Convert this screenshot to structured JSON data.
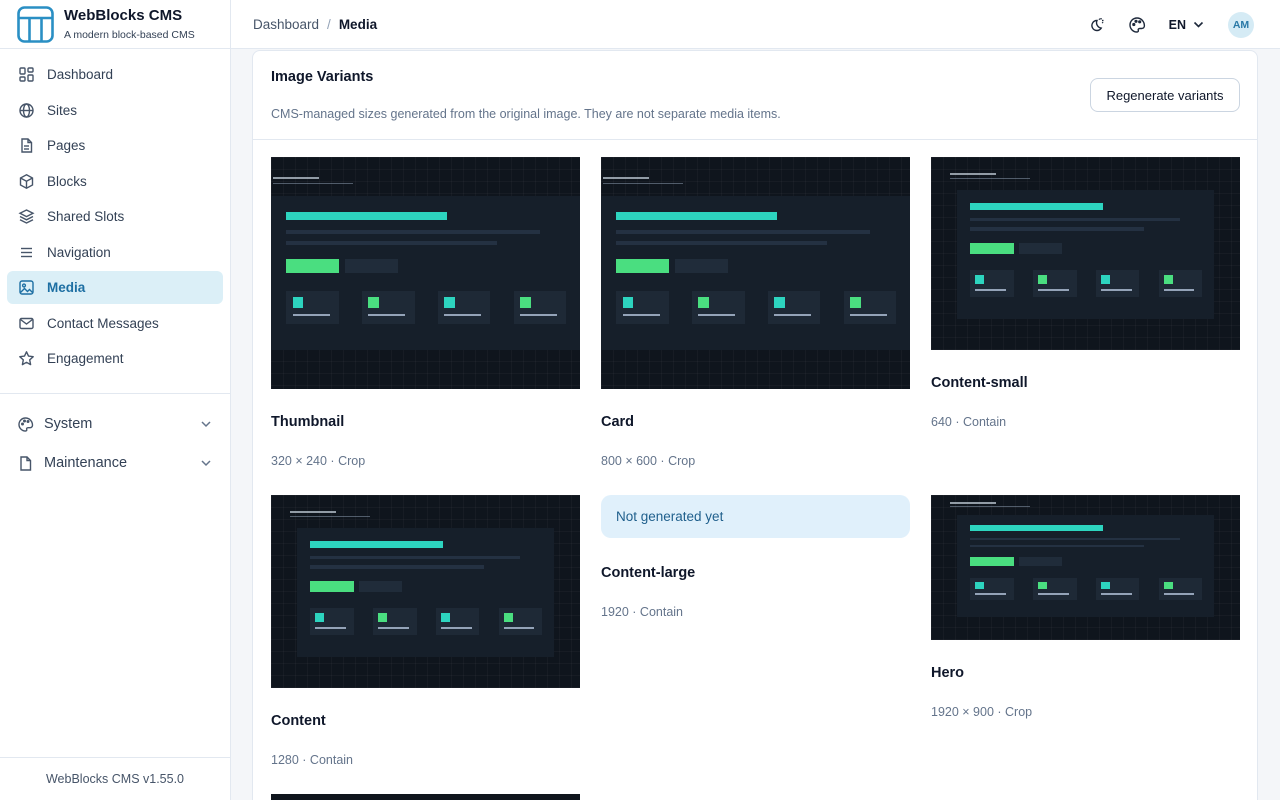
{
  "brand": {
    "title": "WebBlocks CMS",
    "subtitle": "A modern block-based CMS"
  },
  "nav": [
    {
      "label": "Dashboard",
      "icon": "dashboard-icon"
    },
    {
      "label": "Sites",
      "icon": "globe-icon"
    },
    {
      "label": "Pages",
      "icon": "page-icon"
    },
    {
      "label": "Blocks",
      "icon": "cube-icon"
    },
    {
      "label": "Shared Slots",
      "icon": "layers-icon"
    },
    {
      "label": "Navigation",
      "icon": "menu-icon"
    },
    {
      "label": "Media",
      "icon": "image-icon",
      "active": true
    },
    {
      "label": "Contact Messages",
      "icon": "mail-icon"
    },
    {
      "label": "Engagement",
      "icon": "star-icon"
    }
  ],
  "nav_groups": [
    {
      "label": "System",
      "icon": "palette-icon"
    },
    {
      "label": "Maintenance",
      "icon": "file-icon"
    }
  ],
  "footer": {
    "version": "WebBlocks CMS v1.55.0"
  },
  "breadcrumb": {
    "parent": "Dashboard",
    "separator": "/",
    "current": "Media"
  },
  "topbar": {
    "lang": "EN",
    "avatar": "AM"
  },
  "panel": {
    "title": "Image Variants",
    "description": "CMS-managed sizes generated from the original image. They are not separate media items.",
    "regenerate_label": "Regenerate variants"
  },
  "variants": [
    {
      "name": "Thumbnail",
      "meta": "320 × 240 · Crop"
    },
    {
      "name": "Card",
      "meta": "800 × 600 · Crop"
    },
    {
      "name": "Content-small",
      "meta": "640 · Contain"
    },
    {
      "name": "Content",
      "meta": "1280 · Contain"
    },
    {
      "name": "Content-large",
      "meta": "1920 · Contain",
      "status": "Not generated yet"
    },
    {
      "name": "Hero",
      "meta": "1920 × 900 · Crop"
    }
  ],
  "colors": {
    "accent": "#2dd4bf",
    "accent_green": "#4ade80",
    "active_nav_bg": "#dbeff7",
    "active_nav_text": "#1d6fa3"
  }
}
